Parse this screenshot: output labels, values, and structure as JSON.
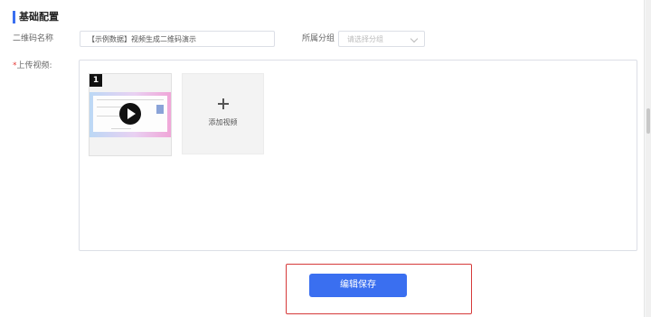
{
  "section": {
    "title": "基础配置"
  },
  "fields": {
    "qr_name": {
      "label": "二维码名称",
      "value": "【示例数据】视频生成二维码演示"
    },
    "group": {
      "label": "所属分组",
      "placeholder": "请选择分组"
    },
    "upload": {
      "required_mark": "*",
      "label": "上传视频:"
    }
  },
  "videos": [
    {
      "index": "1"
    }
  ],
  "add_video": {
    "label": "添加视频"
  },
  "save": {
    "label": "编辑保存"
  },
  "colors": {
    "accent": "#3a6ff0",
    "highlight": "#d63a3a"
  }
}
